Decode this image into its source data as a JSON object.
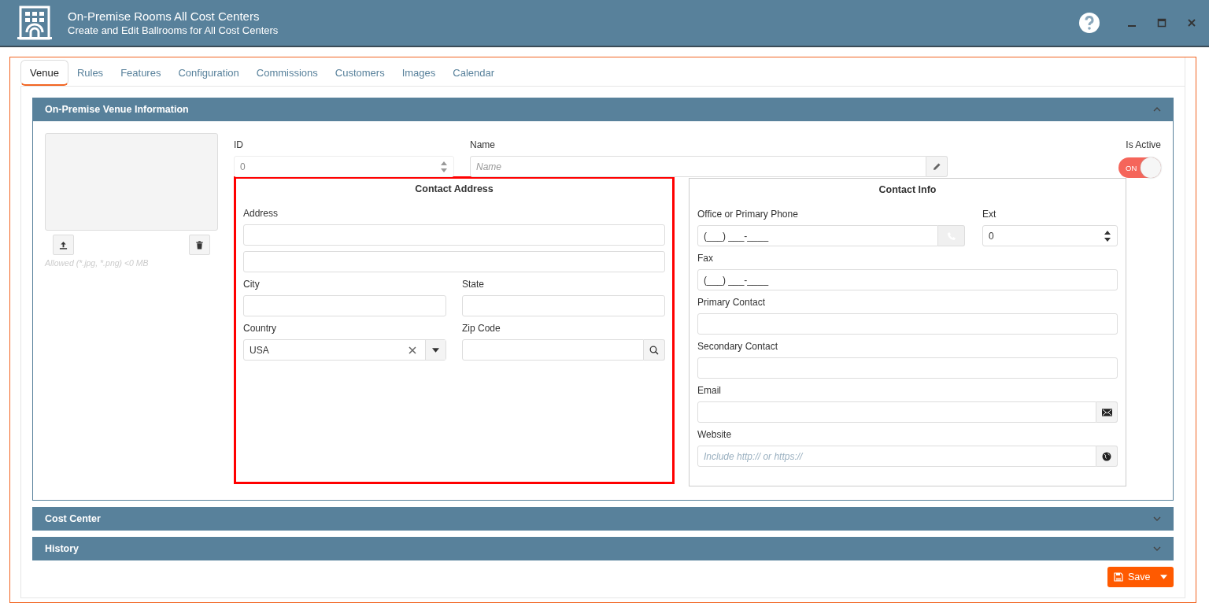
{
  "window": {
    "title": "On-Premise Rooms All Cost Centers",
    "subtitle": "Create and Edit Ballrooms for All Cost Centers"
  },
  "tabs": [
    {
      "label": "Venue",
      "selected": true
    },
    {
      "label": "Rules",
      "selected": false
    },
    {
      "label": "Features",
      "selected": false
    },
    {
      "label": "Configuration",
      "selected": false
    },
    {
      "label": "Commissions",
      "selected": false
    },
    {
      "label": "Customers",
      "selected": false
    },
    {
      "label": "Images",
      "selected": false
    },
    {
      "label": "Calendar",
      "selected": false
    }
  ],
  "sections": [
    {
      "title": "On-Premise Venue Information",
      "expanded": true
    },
    {
      "title": "Cost Center",
      "expanded": false
    },
    {
      "title": "History",
      "expanded": false
    }
  ],
  "image": {
    "hint": "Allowed (*.jpg, *.png) <0 MB"
  },
  "id_field": {
    "label": "ID",
    "value": "0"
  },
  "name_field": {
    "label": "Name",
    "placeholder": "Name"
  },
  "is_active": {
    "label": "Is Active",
    "on": true,
    "text": "ON"
  },
  "contact_address": {
    "title": "Contact Address",
    "highlighted": true,
    "address_label": "Address",
    "city_label": "City",
    "state_label": "State",
    "country_label": "Country",
    "country_value": "USA",
    "zip_label": "Zip Code"
  },
  "contact_info": {
    "title": "Contact Info",
    "phone_label": "Office or Primary Phone",
    "phone_value": "(___) ___-____",
    "ext_label": "Ext",
    "ext_value": "0",
    "fax_label": "Fax",
    "fax_value": "(___) ___-____",
    "primary_label": "Primary Contact",
    "secondary_label": "Secondary Contact",
    "email_label": "Email",
    "website_label": "Website",
    "website_placeholder": "Include http:// or https://"
  },
  "save": {
    "label": "Save"
  }
}
